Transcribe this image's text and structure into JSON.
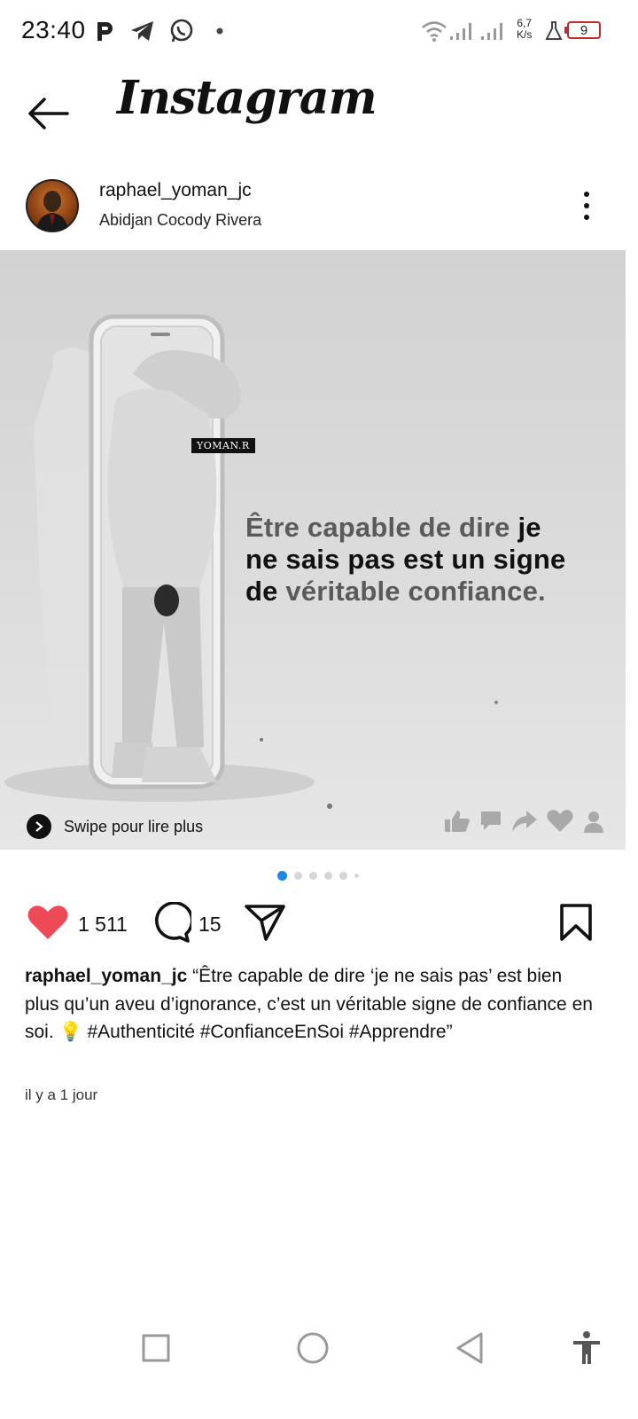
{
  "status_bar": {
    "time": "23:40",
    "speed_value": "6,7",
    "speed_unit": "K/s",
    "battery": "9",
    "icons": [
      "p-icon",
      "telegram-icon",
      "whatsapp-icon",
      "dot-icon",
      "wifi-icon",
      "signal-icon",
      "signal-icon",
      "flask-icon",
      "battery-icon"
    ]
  },
  "header": {
    "title": "Instagram"
  },
  "post": {
    "username": "raphael_yoman_jc",
    "location": "Abidjan Cocody Rivera",
    "image": {
      "watermark": "YOMAN.R",
      "quote_line1_muted": "Être capable de dire ",
      "quote_line1_strong": "je",
      "quote_line2": "ne sais pas est un signe",
      "quote_line3_strong": "de ",
      "quote_line3_muted": "véritable confiance.",
      "swipe_label": "Swipe pour lire plus"
    },
    "carousel": {
      "slide_count": 6,
      "active_index": 0
    },
    "likes": "1 511",
    "comments": "15",
    "caption_user": "raphael_yoman_jc",
    "caption_text": "“Être capable de dire ‘je ne sais pas’ est bien plus qu’un aveu d’ignorance, c’est un véritable signe de confiance en soi. 💡 #Authenticité #ConfianceEnSoi #Apprendre”",
    "time_ago": "il y a 1 jour"
  },
  "colors": {
    "like": "#ed4956",
    "dot_active": "#1e88e5",
    "battery_border": "#c62828"
  },
  "nav_bar": [
    "recents-button",
    "home-button",
    "back-button",
    "accessibility-button"
  ]
}
